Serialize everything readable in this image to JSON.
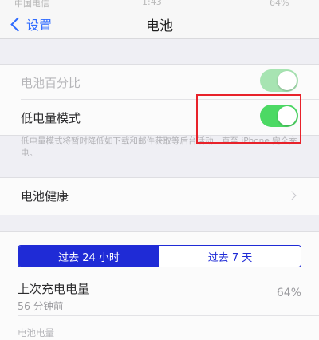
{
  "status_bar": {
    "carrier": "中国电信",
    "time": "1:43",
    "battery": "64%"
  },
  "nav": {
    "back_label": "设置",
    "title": "电池"
  },
  "settings": {
    "battery_percentage": {
      "label": "电池百分比",
      "enabled": false,
      "on": true
    },
    "low_power_mode": {
      "label": "低电量模式",
      "enabled": true,
      "on": true
    },
    "low_power_note": "低电量模式将暂时降低如下载和邮件获取等后台活动，直至 iPhone 完全充电。"
  },
  "battery_health": {
    "label": "电池健康"
  },
  "usage": {
    "segments": [
      {
        "label": "过去 24 小时",
        "selected": true
      },
      {
        "label": "过去 7 天",
        "selected": false
      }
    ],
    "last_charge": {
      "title": "上次充电电量",
      "time": "56 分钟前",
      "value": "64%"
    },
    "battery_level_label": "电池电量"
  },
  "colors": {
    "toggle_on": "#4cd964",
    "toggle_disabled_on": "#a7e4b2",
    "tint": "#2f6bff",
    "segment_selected": "#1f2bd6",
    "highlight": "#e8222a"
  },
  "icons": {
    "back": "chevron-left-icon",
    "disclosure": "chevron-right-icon"
  }
}
